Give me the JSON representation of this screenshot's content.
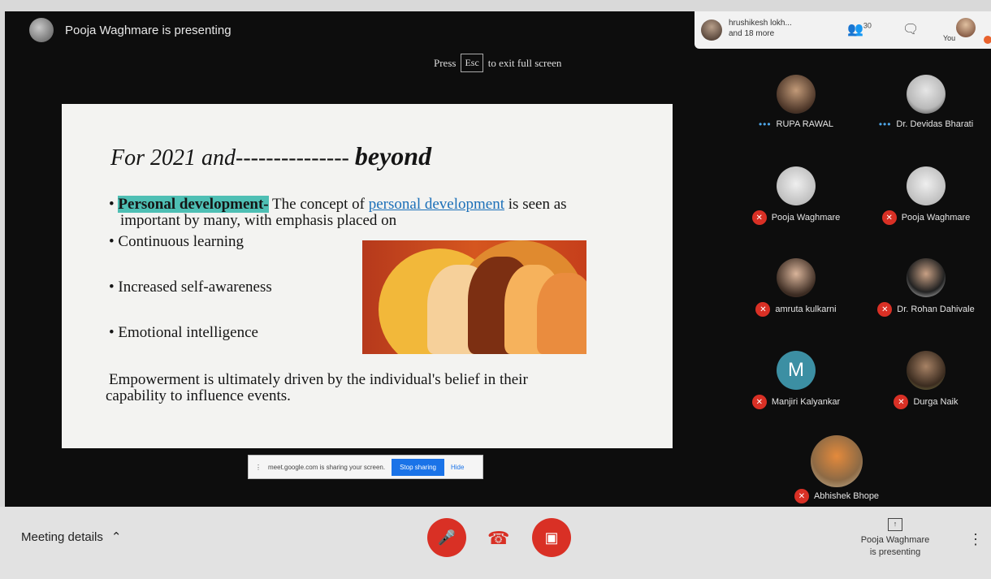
{
  "stage": {
    "presenter_line": "Pooja Waghmare is presenting",
    "esc_prefix": "Press",
    "esc_key": "Esc",
    "esc_suffix": "to exit full screen"
  },
  "top_bar": {
    "participants_line1": "hrushikesh lokh...",
    "participants_line2": "and 18 more",
    "people_count": "30",
    "you_label": "You"
  },
  "slide": {
    "title_italic": "For 2021 and",
    "title_dashes": "---------------",
    "title_bold": "beyond",
    "b1_highlight": "Personal development-",
    "b1_text1": " The concept of ",
    "b1_link": "personal development",
    "b1_text2": " is seen as",
    "b1_line2": "important by many, with emphasis placed on",
    "b2": "• Continuous learning",
    "b3": "• Increased self-awareness",
    "b4": "• Emotional intelligence",
    "closing_line1": "Empowerment is ultimately driven by the individual's belief in their",
    "closing_line2": "capability to influence events."
  },
  "share_bar": {
    "message": "meet.google.com is sharing your screen.",
    "stop_label": "Stop sharing",
    "hide_label": "Hide"
  },
  "participants": [
    {
      "name": "RUPA RAWAL",
      "status": "dots"
    },
    {
      "name": "Dr. Devidas Bharati",
      "status": "dots"
    },
    {
      "name": "Pooja Waghmare",
      "status": "muted"
    },
    {
      "name": "Pooja Waghmare",
      "status": "muted"
    },
    {
      "name": "amruta kulkarni",
      "status": "muted"
    },
    {
      "name": "Dr. Rohan Dahivale",
      "status": "muted"
    },
    {
      "name": "Manjiri Kalyankar",
      "status": "muted",
      "initial": "M"
    },
    {
      "name": "Durga Naik",
      "status": "muted"
    },
    {
      "name": "Abhishek Bhope",
      "status": "muted"
    }
  ],
  "bottom": {
    "meeting_details": "Meeting details",
    "presenting_line1": "Pooja Waghmare",
    "presenting_line2": "is presenting"
  },
  "colors": {
    "mute_red": "#d93025",
    "accent_blue": "#1a73e8",
    "highlight_teal": "#4ebfb4"
  }
}
